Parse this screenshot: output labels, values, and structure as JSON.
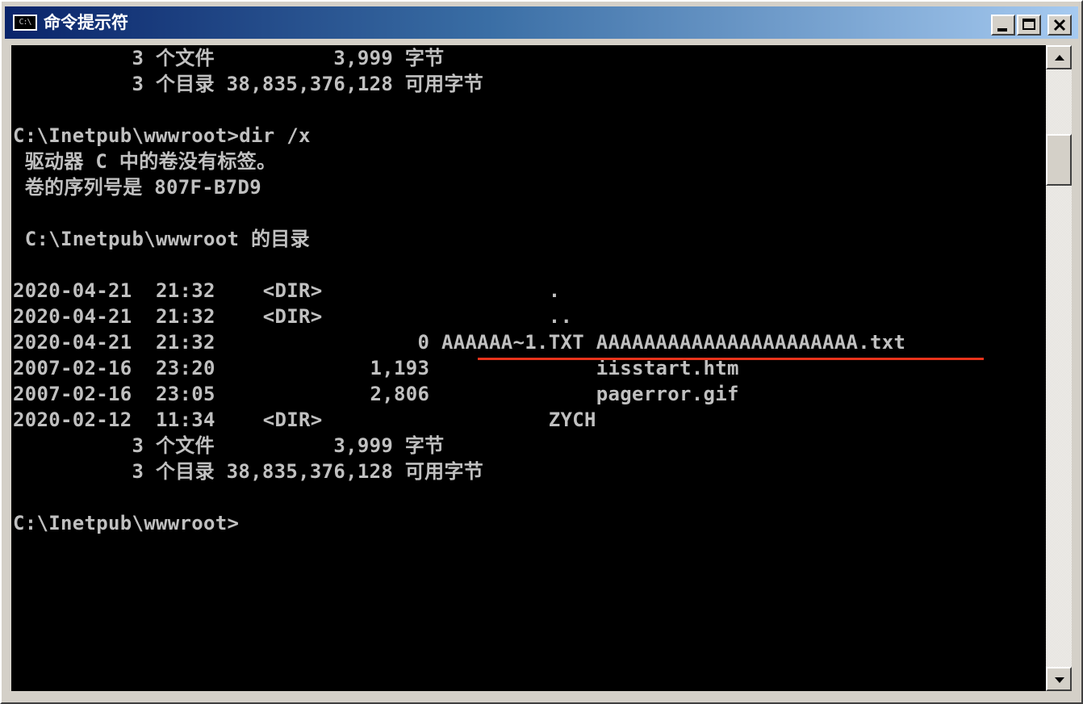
{
  "window": {
    "title": "命令提示符",
    "icon": "C:\\",
    "controls": {
      "minimize": "minimize-icon",
      "maximize": "maximize-icon",
      "close": "close-icon"
    }
  },
  "console": {
    "lines": [
      "          3 个文件          3,999 字节",
      "          3 个目录 38,835,376,128 可用字节",
      "",
      "C:\\Inetpub\\wwwroot>dir /x",
      " 驱动器 C 中的卷没有标签。",
      " 卷的序列号是 807F-B7D9",
      "",
      " C:\\Inetpub\\wwwroot 的目录",
      "",
      "2020-04-21  21:32    <DIR>                   .",
      "2020-04-21  21:32    <DIR>                   ..",
      "2020-04-21  21:32                 0 AAAAAA~1.TXT AAAAAAAAAAAAAAAAAAAAAA.txt",
      "2007-02-16  23:20             1,193              iisstart.htm",
      "2007-02-16  23:05             2,806              pagerror.gif",
      "2020-02-12  11:34    <DIR>                   ZYCH",
      "          3 个文件          3,999 字节",
      "          3 个目录 38,835,376,128 可用字节",
      "",
      "C:\\Inetpub\\wwwroot>"
    ],
    "colors": {
      "background": "#000000",
      "text": "#c0c0c0",
      "annotation_underline": "#e8331b"
    }
  },
  "titlebar_colors": [
    "#0a246a",
    "#a6caf0"
  ]
}
